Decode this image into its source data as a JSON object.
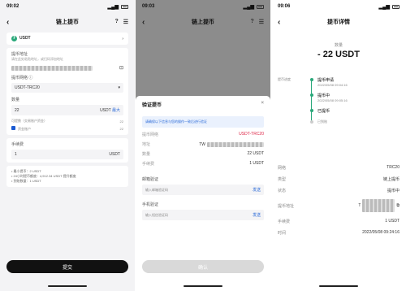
{
  "p1": {
    "time": "09:02",
    "title": "链上提币",
    "coin": "USDT",
    "address_label": "提币地址",
    "address_hint": "请在此处粘贴地址，或扫码添加地址",
    "network_label": "提币网络 ⓘ",
    "network_value": "USDT-TRC20",
    "amount_label": "数量",
    "amount_value": "22",
    "amount_unit": "USDT",
    "amount_max": "最大",
    "avail_label": "可提数（交易账户资金）",
    "avail_value": "22",
    "fund_label": "资金账户",
    "fund_value": "22",
    "fee_label": "手续费",
    "fee_value": "1",
    "fee_unit": "USDT",
    "info1": "• 最小提币：2 USDT",
    "info2": "• 24小时提币额度：4,912.34 USDT 提升额度",
    "info3": "• 到账数量：1 USDT",
    "submit": "提交"
  },
  "p2": {
    "time": "09:03",
    "title": "链上提币",
    "sheet_title": "验证提币",
    "notice": "请确保以下信息与您的操作一致后进行验证",
    "k1": "提币网络",
    "v1": "USDT-TRC20",
    "k2": "地址",
    "v2": "TW",
    "k3": "数量",
    "v3": "22 USDT",
    "k4": "手续费",
    "v4": "1 USDT",
    "email_label": "邮箱验证",
    "email_ph": "输入邮箱验证码",
    "email_send": "发送",
    "phone_label": "手机验证",
    "phone_ph": "输入短信验证码",
    "phone_send": "发送",
    "confirm": "确认"
  },
  "p3": {
    "time": "09:06",
    "title": "提币详情",
    "amount_label": "数量",
    "amount": "- 22 USDT",
    "status_label": "提币进度",
    "s1": "提币申请",
    "s1t": "2022/05/08 09:04:16",
    "s2": "提币中",
    "s2t": "2022/05/08 09:05:16",
    "s3": "已提币",
    "s3t": "已发送至链上。请等待确认",
    "s4": "已到账",
    "rows": [
      {
        "k": "网络",
        "v": "TRC20"
      },
      {
        "k": "类型",
        "v": "链上提币"
      },
      {
        "k": "状态",
        "v": "提币中"
      },
      {
        "k": "提币地址",
        "v": "T"
      },
      {
        "k": "手续费",
        "v": "1 USDT"
      },
      {
        "k": "时间",
        "v": "2022/05/08 09:24:16"
      }
    ]
  }
}
